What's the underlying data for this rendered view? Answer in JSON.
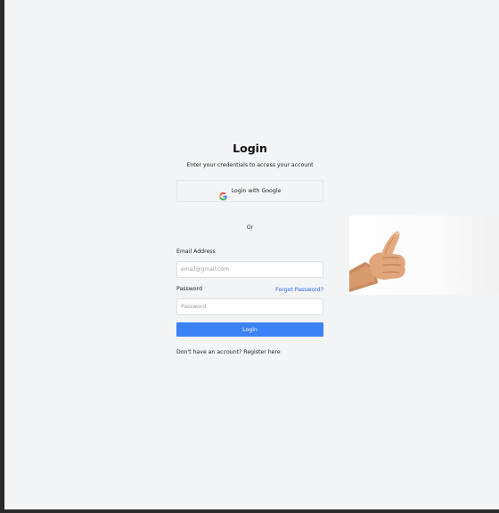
{
  "login": {
    "title": "Login",
    "subtitle": "Enter your credentials to access your account",
    "google_button_label": "Login with Google",
    "divider": "Or",
    "email_label": "Email Address",
    "email_placeholder": "email@gmail.com",
    "email_value": "",
    "password_label": "Password",
    "forgot_password": "Forgot Password?",
    "password_placeholder": "Password",
    "password_value": "",
    "submit_label": "Login",
    "register_prompt": "Don't have an account? Register here"
  },
  "side_image": {
    "subject": "thumbs-up hand photo"
  },
  "colors": {
    "page_background": "#f3f4f6",
    "primary_button": "#3b82f6",
    "link": "#2563eb",
    "outer_frame": "#2b2b2b"
  }
}
